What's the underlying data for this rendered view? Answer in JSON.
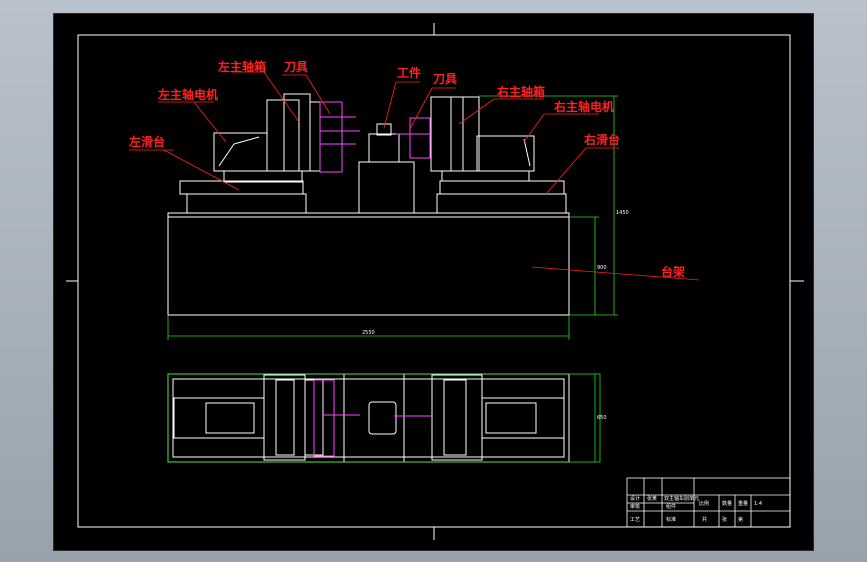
{
  "labels": {
    "left_spindle_box": "左主轴箱",
    "tool_left": "刀具",
    "workpiece": "工件",
    "tool_right": "刀具",
    "left_spindle_motor": "左主轴电机",
    "right_spindle_box": "右主轴箱",
    "right_spindle_motor": "右主轴电机",
    "left_slide": "左滑台",
    "right_slide": "右滑台",
    "frame": "台架"
  },
  "dimensions": {
    "overall_length": "2550",
    "frame_height": "900",
    "total_height": "1450",
    "plan_width": "650"
  },
  "title_block": {
    "r1c1": "设计",
    "r1c2": "张某",
    "r1c3": "双主轴车削单元",
    "r2c1": "审核",
    "r2c3": "组件",
    "r2c4": "比例",
    "r2c5": "数量",
    "r2c6": "重量",
    "r3c1": "工艺",
    "r3c3": "标准",
    "r3c4": "共",
    "r3c5": "张",
    "r3c6": "第",
    "scale": "1:4"
  },
  "colors": {
    "background": "#000000",
    "outline": "#ffffff",
    "label": "#ff2020",
    "leader": "#ff2020",
    "dimension": "#22dd22",
    "tool": "#ff44ff"
  }
}
